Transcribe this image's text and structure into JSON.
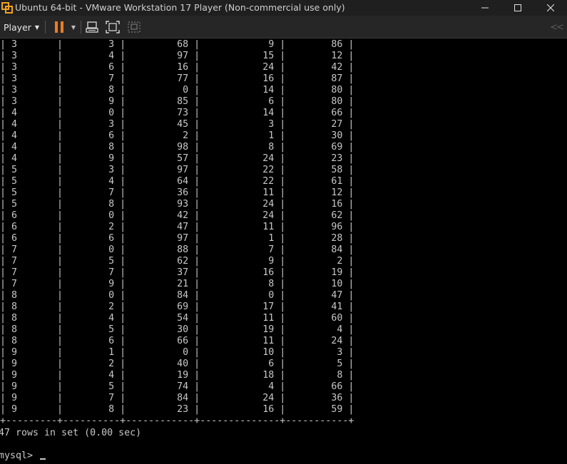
{
  "window": {
    "title": "Ubuntu 64-bit - VMware Workstation 17 Player (Non-commercial use only)",
    "icons": [
      "vmware-logo-icon",
      "minimize-icon",
      "maximize-icon",
      "close-icon"
    ]
  },
  "toolbar": {
    "player_label": "Player",
    "icons": [
      "pause-icon",
      "dropdown-icon",
      "send-ctrl-alt-del-icon",
      "fullscreen-icon",
      "unity-icon",
      "collapse-icon"
    ],
    "accent_color": "#f07c21"
  },
  "terminal": {
    "rows": [
      [
        "3",
        "3",
        "68",
        "9",
        "86"
      ],
      [
        "3",
        "4",
        "97",
        "15",
        "12"
      ],
      [
        "3",
        "6",
        "16",
        "24",
        "42"
      ],
      [
        "3",
        "7",
        "77",
        "16",
        "87"
      ],
      [
        "3",
        "8",
        "0",
        "14",
        "80"
      ],
      [
        "3",
        "9",
        "85",
        "6",
        "80"
      ],
      [
        "4",
        "0",
        "73",
        "14",
        "66"
      ],
      [
        "4",
        "3",
        "45",
        "3",
        "27"
      ],
      [
        "4",
        "6",
        "2",
        "1",
        "30"
      ],
      [
        "4",
        "8",
        "98",
        "8",
        "69"
      ],
      [
        "4",
        "9",
        "57",
        "24",
        "23"
      ],
      [
        "5",
        "3",
        "97",
        "22",
        "58"
      ],
      [
        "5",
        "4",
        "64",
        "22",
        "61"
      ],
      [
        "5",
        "7",
        "36",
        "11",
        "12"
      ],
      [
        "5",
        "8",
        "93",
        "24",
        "16"
      ],
      [
        "6",
        "0",
        "42",
        "24",
        "62"
      ],
      [
        "6",
        "2",
        "47",
        "11",
        "96"
      ],
      [
        "6",
        "6",
        "97",
        "1",
        "28"
      ],
      [
        "7",
        "0",
        "88",
        "7",
        "84"
      ],
      [
        "7",
        "5",
        "62",
        "9",
        "2"
      ],
      [
        "7",
        "7",
        "37",
        "16",
        "19"
      ],
      [
        "7",
        "9",
        "21",
        "8",
        "10"
      ],
      [
        "8",
        "0",
        "84",
        "0",
        "47"
      ],
      [
        "8",
        "2",
        "69",
        "17",
        "41"
      ],
      [
        "8",
        "4",
        "54",
        "11",
        "60"
      ],
      [
        "8",
        "5",
        "30",
        "19",
        "4"
      ],
      [
        "8",
        "6",
        "66",
        "11",
        "24"
      ],
      [
        "9",
        "1",
        "0",
        "10",
        "3"
      ],
      [
        "9",
        "2",
        "40",
        "6",
        "5"
      ],
      [
        "9",
        "4",
        "19",
        "18",
        "8"
      ],
      [
        "9",
        "5",
        "74",
        "4",
        "66"
      ],
      [
        "9",
        "7",
        "84",
        "24",
        "36"
      ],
      [
        "9",
        "8",
        "23",
        "16",
        "59"
      ]
    ],
    "table_border": "+---------+----------+------------+--------------+-----------+",
    "result_text": "47 rows in set (0.00 sec)",
    "prompt": "mysql> "
  }
}
